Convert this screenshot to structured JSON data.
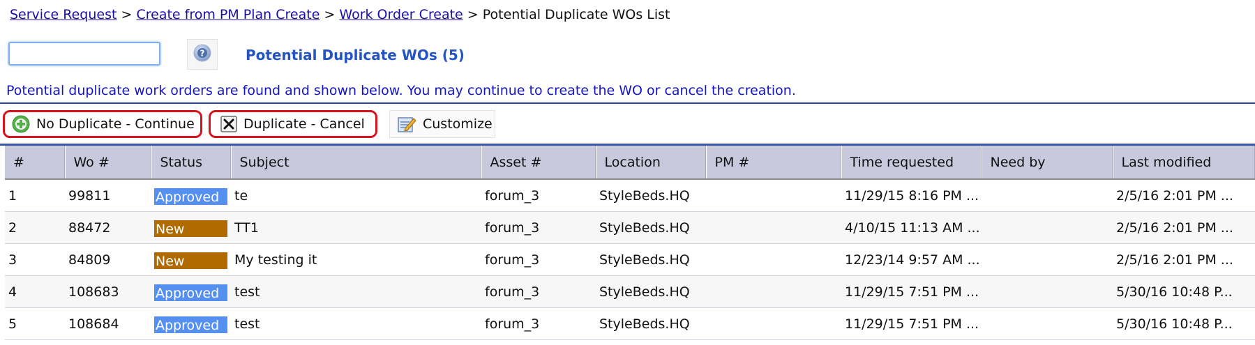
{
  "breadcrumb": {
    "links": [
      "Service Request",
      "Create from PM Plan Create",
      "Work Order Create"
    ],
    "separator": ">",
    "current": "Potential Duplicate WOs List"
  },
  "search": {
    "value": "",
    "placeholder": ""
  },
  "help": {
    "icon": "help-icon"
  },
  "page_title": "Potential Duplicate WOs (5)",
  "info_text": "Potential duplicate work orders are found and shown below. You may continue to create the WO or cancel the creation.",
  "toolbar": {
    "continue_label": "No Duplicate - Continue",
    "cancel_label": "Duplicate - Cancel",
    "customize_label": "Customize"
  },
  "colors": {
    "approved": "#5590f0",
    "new": "#b06a00",
    "highlight": "#d6141e",
    "header_bg": "#c9c9dd"
  },
  "table": {
    "columns": [
      "#",
      "Wo #",
      "Status",
      "Subject",
      "Asset #",
      "Location",
      "PM #",
      "Time requested",
      "Need by",
      "Last modified"
    ],
    "rows": [
      {
        "n": "1",
        "wo": "99811",
        "status": "Approved",
        "subject": "te",
        "asset": "forum_3",
        "location": "StyleBeds.HQ",
        "pm": "",
        "time_requested": "11/29/15 8:16 PM ...",
        "need_by": "",
        "last_modified": "2/5/16 2:01 PM ..."
      },
      {
        "n": "2",
        "wo": "88472",
        "status": "New",
        "subject": "TT1",
        "asset": "forum_3",
        "location": "StyleBeds.HQ",
        "pm": "",
        "time_requested": "4/10/15 11:13 AM ...",
        "need_by": "",
        "last_modified": "2/5/16 2:01 PM ..."
      },
      {
        "n": "3",
        "wo": "84809",
        "status": "New",
        "subject": "My testing it",
        "asset": "forum_3",
        "location": "StyleBeds.HQ",
        "pm": "",
        "time_requested": "12/23/14 9:57 AM ...",
        "need_by": "",
        "last_modified": "2/5/16 2:01 PM ..."
      },
      {
        "n": "4",
        "wo": "108683",
        "status": "Approved",
        "subject": "test",
        "asset": "forum_3",
        "location": "StyleBeds.HQ",
        "pm": "",
        "time_requested": "11/29/15 7:51 PM ...",
        "need_by": "",
        "last_modified": "5/30/16 10:48 P..."
      },
      {
        "n": "5",
        "wo": "108684",
        "status": "Approved",
        "subject": "test",
        "asset": "forum_3",
        "location": "StyleBeds.HQ",
        "pm": "",
        "time_requested": "11/29/15 7:51 PM ...",
        "need_by": "",
        "last_modified": "5/30/16 10:48 P..."
      }
    ]
  }
}
